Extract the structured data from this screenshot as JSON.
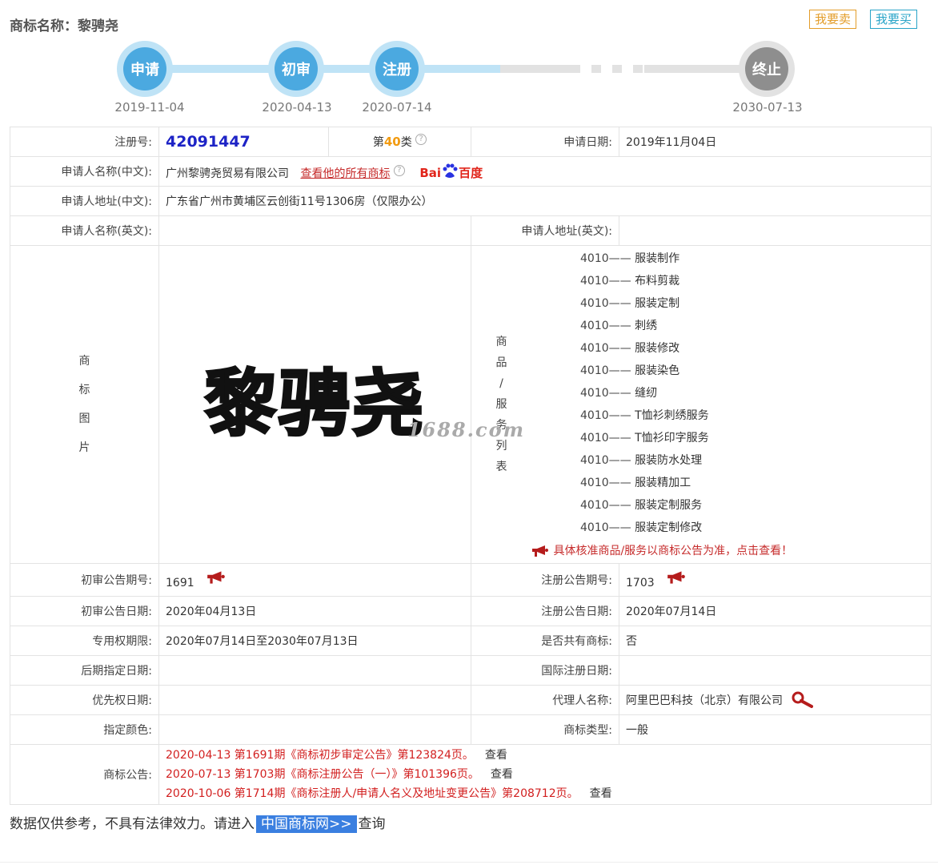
{
  "header": {
    "title": "商标名称：黎骋尧",
    "sell_button": "我要卖",
    "buy_button": "我要买"
  },
  "timeline": [
    {
      "label": "申请",
      "date": "2019-11-04",
      "state": "done"
    },
    {
      "label": "初审",
      "date": "2020-04-13",
      "state": "done"
    },
    {
      "label": "注册",
      "date": "2020-07-14",
      "state": "done"
    },
    {
      "label": "终止",
      "date": "2030-07-13",
      "state": "pending"
    }
  ],
  "details": {
    "reg_no_label": "注册号:",
    "reg_no": "42091447",
    "class_prefix": "第",
    "class_num": "40",
    "class_suffix": "类",
    "apply_date_label": "申请日期:",
    "apply_date": "2019年11月04日",
    "applicant_cn_label": "申请人名称(中文):",
    "applicant_cn": "广州黎骋尧贸易有限公司",
    "view_all_link": "查看他的所有商标",
    "baidu_logo": "Bai百度",
    "address_cn_label": "申请人地址(中文):",
    "address_cn": "广东省广州市黄埔区云创街11号1306房（仅限办公）",
    "applicant_en_label": "申请人名称(英文):",
    "applicant_en": "",
    "address_en_label": "申请人地址(英文):",
    "address_en": "",
    "image_label_chars": [
      "商",
      "标",
      "图",
      "片"
    ],
    "trademark_text": "黎骋尧",
    "watermark": "1688.com",
    "goods_label_chars": [
      "商",
      "品",
      "/",
      "服",
      "务",
      "列",
      "表"
    ],
    "goods": [
      {
        "code": "4010——",
        "name": "服装制作"
      },
      {
        "code": "4010——",
        "name": "布料剪裁"
      },
      {
        "code": "4010——",
        "name": "服装定制"
      },
      {
        "code": "4010——",
        "name": "刺绣"
      },
      {
        "code": "4010——",
        "name": "服装修改"
      },
      {
        "code": "4010——",
        "name": "服装染色"
      },
      {
        "code": "4010——",
        "name": "缝纫"
      },
      {
        "code": "4010——",
        "name": "T恤衫刺绣服务"
      },
      {
        "code": "4010——",
        "name": "T恤衫印字服务"
      },
      {
        "code": "4010——",
        "name": "服装防水处理"
      },
      {
        "code": "4010——",
        "name": "服装精加工"
      },
      {
        "code": "4010——",
        "name": "服装定制服务"
      },
      {
        "code": "4010——",
        "name": "服装定制修改"
      }
    ],
    "goods_notice": "具体核准商品/服务以商标公告为准，点击查看！",
    "prelim_issue_label": "初审公告期号:",
    "prelim_issue": "1691",
    "reg_issue_label": "注册公告期号:",
    "reg_issue": "1703",
    "prelim_date_label": "初审公告日期:",
    "prelim_date": "2020年04月13日",
    "reg_date_label": "注册公告日期:",
    "reg_date": "2020年07月14日",
    "exclusive_label": "专用权期限:",
    "exclusive": "2020年07月14日至2030年07月13日",
    "shared_label": "是否共有商标:",
    "shared": "否",
    "later_date_label": "后期指定日期:",
    "later_date": "",
    "intl_date_label": "国际注册日期:",
    "intl_date": "",
    "priority_label": "优先权日期:",
    "priority": "",
    "agent_label": "代理人名称:",
    "agent": "阿里巴巴科技（北京）有限公司",
    "color_label": "指定颜色:",
    "color": "",
    "type_label": "商标类型:",
    "type": "一般",
    "notice_label": "商标公告:",
    "notices": [
      {
        "text": "2020-04-13 第1691期《商标初步审定公告》第123824页。",
        "view": "查看"
      },
      {
        "text": "2020-07-13 第1703期《商标注册公告（一）》第101396页。",
        "view": "查看"
      },
      {
        "text": "2020-10-06 第1714期《商标注册人/申请人名义及地址变更公告》第208712页。",
        "view": "查看"
      }
    ]
  },
  "footer": {
    "text_before": "数据仅供参考，不具有法律效力。请进入",
    "link": "中国商标网>>",
    "text_after": "查询"
  },
  "colors": {
    "accent_blue": "#4ba9e0",
    "gray": "#8e8e8e",
    "red": "#c62b2b",
    "orange": "#f29b11"
  }
}
